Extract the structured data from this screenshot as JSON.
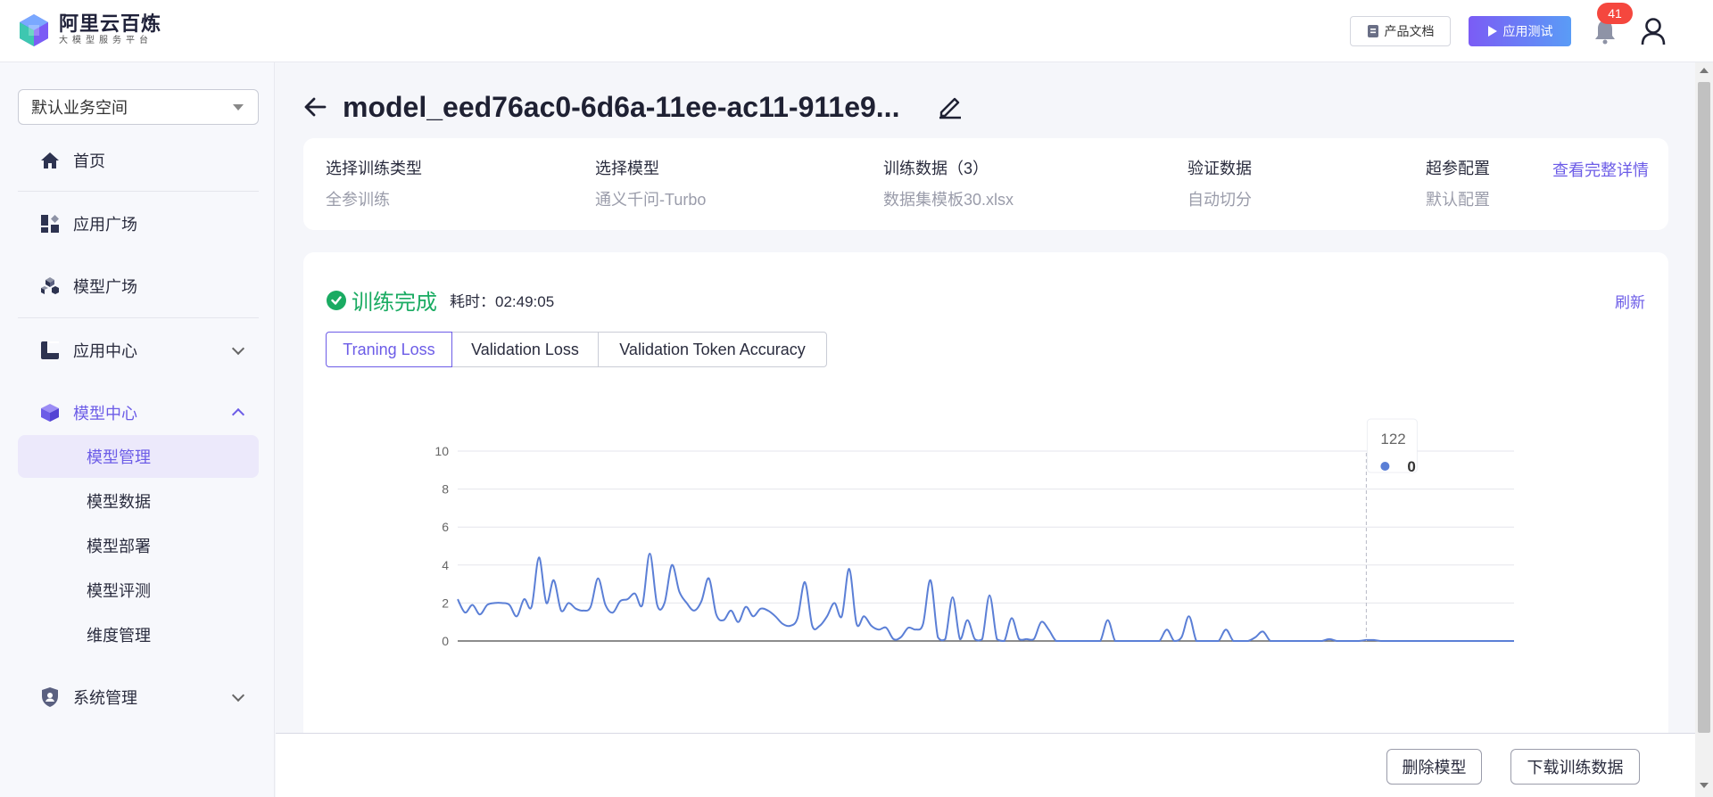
{
  "header": {
    "logo_title": "阿里云百炼",
    "logo_subtitle": "大模型服务平台",
    "docs_label": "产品文档",
    "test_label": "应用测试",
    "notification_count": "41"
  },
  "sidebar": {
    "workspace": "默认业务空间",
    "items": [
      {
        "label": "首页",
        "icon": "home-icon"
      },
      {
        "label": "应用广场",
        "icon": "app-grid-icon"
      },
      {
        "label": "模型广场",
        "icon": "cubes-icon"
      },
      {
        "label": "应用中心",
        "icon": "app-center-icon"
      },
      {
        "label": "模型中心",
        "icon": "model-center-icon"
      },
      {
        "label": "系统管理",
        "icon": "shield-icon"
      }
    ],
    "model_center_subitems": [
      {
        "label": "模型管理"
      },
      {
        "label": "模型数据"
      },
      {
        "label": "模型部署"
      },
      {
        "label": "模型评测"
      },
      {
        "label": "维度管理"
      }
    ]
  },
  "main": {
    "title": "model_eed76ac0-6d6a-11ee-ac11-911e9...",
    "info": [
      {
        "label": "选择训练类型",
        "value": "全参训练"
      },
      {
        "label": "选择模型",
        "value": "通义千问-Turbo"
      },
      {
        "label": "训练数据（3）",
        "value": "数据集模板30.xlsx"
      },
      {
        "label": "验证数据",
        "value": "自动切分"
      },
      {
        "label": "超参配置",
        "value": "默认配置"
      }
    ],
    "view_details": "查看完整详情",
    "status": "训练完成",
    "elapsed": "耗时：02:49:05",
    "refresh": "刷新",
    "tabs": [
      "Traning Loss",
      "Validation Loss",
      "Validation Token Accuracy"
    ],
    "active_tab": 0
  },
  "footer": {
    "delete_label": "删除模型",
    "download_label": "下载训练数据"
  },
  "colors": {
    "accent": "#6c5ce7",
    "success": "#1aab62",
    "line": "#5b7fd6"
  },
  "chart_data": {
    "type": "line",
    "ylim": [
      0,
      10
    ],
    "yticks": [
      "0",
      "2",
      "4",
      "6",
      "8",
      "10"
    ],
    "grid": true,
    "tooltip": {
      "x": "122",
      "value": "0"
    },
    "series": [
      {
        "values": [
          2.2,
          1.5,
          1.9,
          1.4,
          1.9,
          2.0,
          2.0,
          1.9,
          1.3,
          2.2,
          1.8,
          4.4,
          2.0,
          3.2,
          1.6,
          2.0,
          1.7,
          1.6,
          1.8,
          3.3,
          1.9,
          1.5,
          2.1,
          2.2,
          2.5,
          1.9,
          4.6,
          1.9,
          2.0,
          4.0,
          2.6,
          2.0,
          1.6,
          2.1,
          3.3,
          1.4,
          1.1,
          1.6,
          1.0,
          1.8,
          1.3,
          1.7,
          1.6,
          1.3,
          0.9,
          0.8,
          1.2,
          3.1,
          0.8,
          0.8,
          1.3,
          2.0,
          1.3,
          3.8,
          0.9,
          1.3,
          0.8,
          0.6,
          0.7,
          0.1,
          0.2,
          0.7,
          0.6,
          0.9,
          3.2,
          0.2,
          0.1,
          2.3,
          0.1,
          1.1,
          0.1,
          0.1,
          2.4,
          0.1,
          0.0,
          1.2,
          0.1,
          0.1,
          0.1,
          1.0,
          0.6,
          0.0,
          0.0,
          0.0,
          0.0,
          0.0,
          0.0,
          0.0,
          1.1,
          0.0,
          0.0,
          0.0,
          0.0,
          0.0,
          0.0,
          0.0,
          0.6,
          0.0,
          0.2,
          1.3,
          0.0,
          0.0,
          0.0,
          0.0,
          0.6,
          0.0,
          0.0,
          0.0,
          0.2,
          0.5,
          0.0,
          0.0,
          0.0,
          0.0,
          0.0,
          0.0,
          0.0,
          0.0,
          0.1,
          0.0,
          0.0,
          0.0,
          0.0,
          0.05,
          0.05,
          0.0,
          0.0,
          0.0,
          0.0,
          0.0,
          0.0,
          0.0,
          0.0,
          0.0,
          0.0,
          0.0,
          0.0,
          0.0,
          0.0,
          0.0,
          0.0,
          0.0,
          0.0,
          0.0
        ]
      }
    ]
  }
}
